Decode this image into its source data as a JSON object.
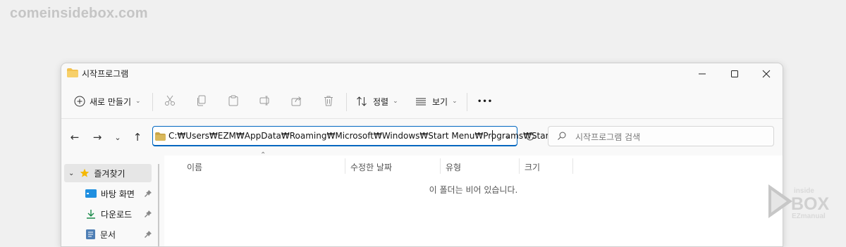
{
  "watermark": "comeinsidebox.com",
  "window": {
    "title": "시작프로그램"
  },
  "toolbar": {
    "new_label": "새로 만들기",
    "sort_label": "정렬",
    "view_label": "보기",
    "more_label": "•••"
  },
  "address": {
    "path": "C:₩Users₩EZM₩AppData₩Roaming₩Microsoft₩Windows₩Start Menu₩Programs₩Startup"
  },
  "search": {
    "placeholder": "시작프로그램 검색"
  },
  "sidebar": {
    "items": [
      {
        "label": "즐겨찾기",
        "icon": "star-icon"
      },
      {
        "label": "바탕 화면",
        "icon": "desktop-icon"
      },
      {
        "label": "다운로드",
        "icon": "download-icon"
      },
      {
        "label": "문서",
        "icon": "document-icon"
      }
    ]
  },
  "columns": [
    "이름",
    "수정한 날짜",
    "유형",
    "크기"
  ],
  "empty_message": "이 폴더는 비어 있습니다.",
  "logo": {
    "line1": "inside",
    "line2": "BOX",
    "line3": "EZmanual"
  },
  "colors": {
    "accent": "#0067c0",
    "folder": "#f2c14e",
    "star": "#f5b800"
  }
}
